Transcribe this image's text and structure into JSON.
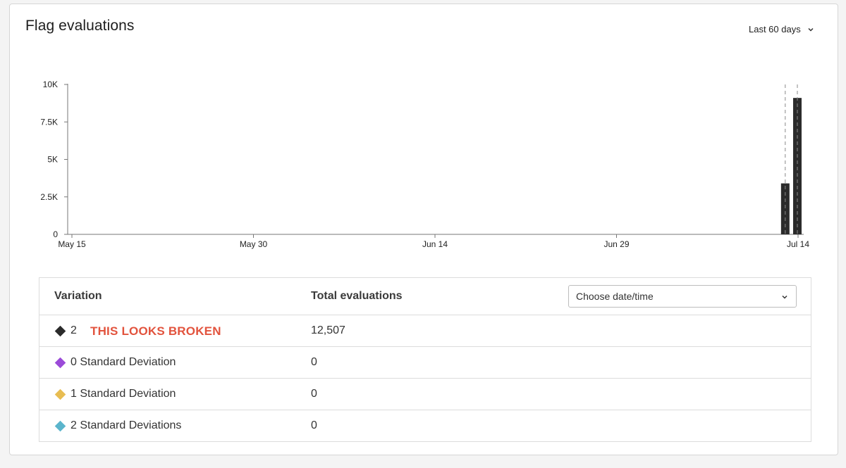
{
  "card": {
    "title": "Flag evaluations",
    "range_label": "Last 60 days"
  },
  "chart_data": {
    "type": "bar",
    "title": "",
    "xlabel": "",
    "ylabel": "",
    "x_tick_labels": [
      "May 15",
      "May 30",
      "Jun 14",
      "Jun 29",
      "Jul 14"
    ],
    "y_tick_labels": [
      "0",
      "2.5K",
      "5K",
      "7.5K",
      "10K"
    ],
    "y_ticks": [
      0,
      2500,
      5000,
      7500,
      10000
    ],
    "ylim": [
      0,
      10000
    ],
    "x_day_range": [
      0,
      60
    ],
    "x_tick_days": [
      0,
      15,
      30,
      45,
      60
    ],
    "bars": [
      {
        "day": 59,
        "value": 3400
      },
      {
        "day": 60,
        "value": 9100
      }
    ],
    "grid": false,
    "bar_color": "#2b2b2b"
  },
  "table": {
    "headers": {
      "variation": "Variation",
      "total": "Total evaluations"
    },
    "date_select": {
      "value": "Choose date/time"
    },
    "annotation": "THIS LOOKS BROKEN",
    "rows": [
      {
        "label": "2",
        "total": "12,507",
        "color": "#2b2b2b"
      },
      {
        "label": "0 Standard Deviation",
        "total": "0",
        "color": "#9b4bd8"
      },
      {
        "label": "1 Standard Deviation",
        "total": "0",
        "color": "#e8bd52"
      },
      {
        "label": "2 Standard Deviations",
        "total": "0",
        "color": "#5bb5cc"
      }
    ]
  }
}
